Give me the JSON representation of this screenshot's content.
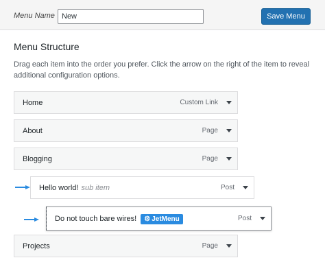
{
  "header": {
    "menu_name_label": "Menu Name",
    "menu_name_value": "New",
    "save_label": "Save Menu"
  },
  "structure": {
    "title": "Menu Structure",
    "instructions": "Drag each item into the order you prefer. Click the arrow on the right of the item to reveal additional configuration options."
  },
  "items": [
    {
      "title": "Home",
      "type": "Custom Link"
    },
    {
      "title": "About",
      "type": "Page"
    },
    {
      "title": "Blogging",
      "type": "Page"
    },
    {
      "title": "Hello world!",
      "sub_label": "sub item",
      "type": "Post"
    },
    {
      "title": "Do not touch bare wires!",
      "badge": "JetMenu",
      "type": "Post"
    },
    {
      "title": "Projects",
      "type": "Page"
    }
  ],
  "colors": {
    "primary_button": "#2271b1",
    "badge": "#2a8be0",
    "pointer_arrow": "#2a8be0"
  },
  "icons": {
    "expand": "triangle-down-icon",
    "badge_icon": "gear-icon",
    "pointer": "arrow-right-icon"
  }
}
